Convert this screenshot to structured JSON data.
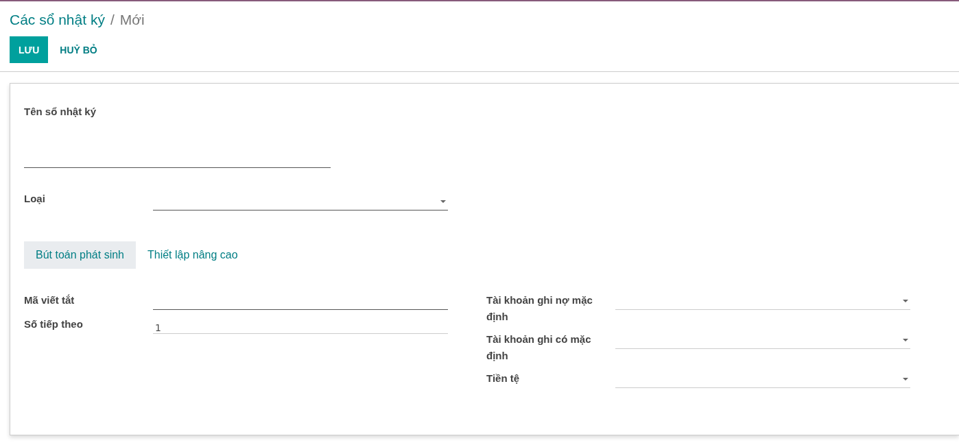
{
  "breadcrumb": {
    "parent": "Các sổ nhật ký",
    "separator": "/",
    "current": "Mới"
  },
  "buttons": [
    {
      "label": "LƯU",
      "kind": "primary"
    },
    {
      "label": "HUỶ BỎ",
      "kind": "link"
    }
  ],
  "name_field": {
    "label": "Tên sổ nhật ký",
    "required": true,
    "dropdown": false
  },
  "type_field": {
    "label": "Loại",
    "required": true,
    "dropdown": true
  },
  "tabs": [
    {
      "label": "Bút toán phát sinh",
      "selected": true
    },
    {
      "label": "Thiết lập nâng cao",
      "selected": false
    }
  ],
  "left_fields": [
    {
      "label": "Mã viết tắt",
      "required": true,
      "dropdown": false
    },
    {
      "label": "Số tiếp theo",
      "value": "1",
      "required": false,
      "dropdown": false
    }
  ],
  "right_fields": [
    {
      "label": "Tài khoản ghi nợ mặc định",
      "required": false,
      "dropdown": true
    },
    {
      "label": "Tài khoản ghi có mặc định",
      "required": false,
      "dropdown": true
    },
    {
      "label": "Tiền tệ",
      "required": false,
      "dropdown": true
    }
  ]
}
